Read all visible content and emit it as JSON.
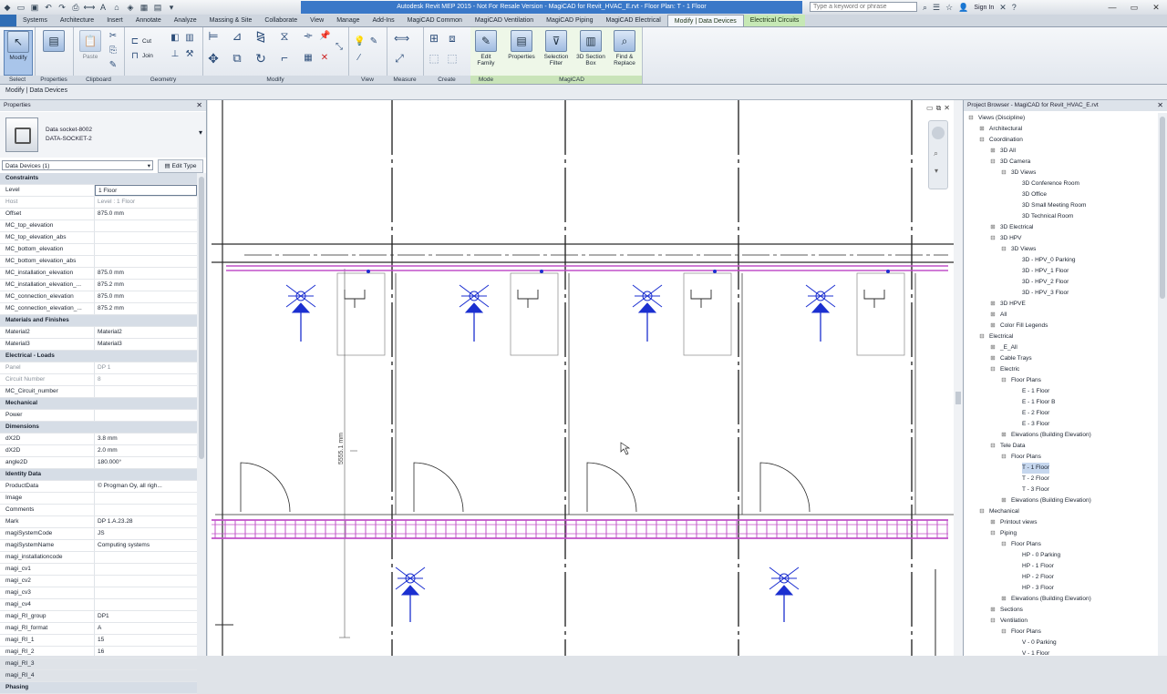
{
  "window": {
    "title": "Autodesk Revit MEP 2015 - Not For Resale Version -   MagiCAD for Revit_HVAC_E.rvt - Floor Plan: T - 1 Floor",
    "search_placeholder": "Type a keyword or phrase",
    "sign_in": "Sign In"
  },
  "tabs": [
    "Systems",
    "Architecture",
    "Insert",
    "Annotate",
    "Analyze",
    "Massing & Site",
    "Collaborate",
    "View",
    "Manage",
    "Add-Ins",
    "MagiCAD Common",
    "MagiCAD Ventilation",
    "MagiCAD Piping",
    "MagiCAD Electrical",
    "Modify | Data Devices",
    "Electrical Circuits"
  ],
  "ribbon": {
    "modify_label": "Modify",
    "select_label": "Select",
    "properties_label": "Properties",
    "clipboard_label": "Clipboard",
    "geometry_label": "Geometry",
    "modify_panel_label": "Modify",
    "view_label": "View",
    "measure_label": "Measure",
    "create_label": "Create",
    "mode_label": "Mode",
    "magicad_label": "MagiCAD",
    "paste_label": "Paste",
    "cut_label": "Cut",
    "join_label": "Join",
    "edit_family_label": "Edit Family",
    "mc_properties_label": "Properties",
    "selection_filter_label": "Selection Filter",
    "section_box_label": "3D Section Box",
    "find_replace_label": "Find & Replace"
  },
  "options_bar": {
    "text": "Modify | Data Devices"
  },
  "properties": {
    "title": "Properties",
    "type_name": "Data socket-8002",
    "type_sub": "DATA-SOCKET-2",
    "filter": "Data Devices (1)",
    "edit_type": "Edit Type",
    "rows": [
      {
        "cat": "Constraints"
      },
      {
        "k": "Level",
        "v": "1 Floor",
        "edit": true
      },
      {
        "k": "Host",
        "v": "Level : 1 Floor",
        "grey": true
      },
      {
        "k": "Offset",
        "v": "875.0 mm"
      },
      {
        "k": "MC_top_elevation",
        "v": ""
      },
      {
        "k": "MC_top_elevation_abs",
        "v": ""
      },
      {
        "k": "MC_bottom_elevation",
        "v": ""
      },
      {
        "k": "MC_bottom_elevation_abs",
        "v": ""
      },
      {
        "k": "MC_installation_elevation",
        "v": "875.0 mm"
      },
      {
        "k": "MC_installation_elevation_...",
        "v": "875.2 mm"
      },
      {
        "k": "MC_connection_elevation",
        "v": "875.0 mm"
      },
      {
        "k": "MC_connection_elevation_...",
        "v": "875.2 mm"
      },
      {
        "cat": "Materials and Finishes"
      },
      {
        "k": "Material2",
        "v": "Material2"
      },
      {
        "k": "Material3",
        "v": "Material3"
      },
      {
        "cat": "Electrical - Loads"
      },
      {
        "k": "Panel",
        "v": "DP 1",
        "grey": true
      },
      {
        "k": "Circuit Number",
        "v": "8",
        "grey": true
      },
      {
        "k": "MC_Circuit_number",
        "v": ""
      },
      {
        "cat": "Mechanical"
      },
      {
        "k": "Power",
        "v": ""
      },
      {
        "cat": "Dimensions"
      },
      {
        "k": "dX2D",
        "v": "3.8 mm"
      },
      {
        "k": "dX2D",
        "v": "2.0 mm"
      },
      {
        "k": "angle2D",
        "v": "180.000°"
      },
      {
        "cat": "Identity Data"
      },
      {
        "k": "ProductData",
        "v": "© Progman Oy, all righ..."
      },
      {
        "k": "Image",
        "v": ""
      },
      {
        "k": "Comments",
        "v": ""
      },
      {
        "k": "Mark",
        "v": "DP 1.A.23.28"
      },
      {
        "k": "magiSystemCode",
        "v": "JS"
      },
      {
        "k": "magiSystemName",
        "v": "Computing systems"
      },
      {
        "k": "magi_installationcode",
        "v": ""
      },
      {
        "k": "magi_cv1",
        "v": ""
      },
      {
        "k": "magi_cv2",
        "v": ""
      },
      {
        "k": "magi_cv3",
        "v": ""
      },
      {
        "k": "magi_cv4",
        "v": ""
      },
      {
        "k": "magi_RI_group",
        "v": "DP1"
      },
      {
        "k": "magi_RI_format",
        "v": "A"
      },
      {
        "k": "magi_RI_1",
        "v": "15"
      },
      {
        "k": "magi_RI_2",
        "v": "16"
      },
      {
        "k": "magi_RI_3",
        "v": ""
      },
      {
        "k": "magi_RI_4",
        "v": ""
      },
      {
        "cat": "Phasing"
      }
    ]
  },
  "canvas": {
    "dimension_text": "5555.1 mm"
  },
  "browser": {
    "title": "Project Browser - MagiCAD for Revit_HVAC_E.rvt",
    "nodes": [
      {
        "d": 0,
        "t": "Views (Discipline)",
        "tog": "−"
      },
      {
        "d": 1,
        "t": "Architectural",
        "tog": "+"
      },
      {
        "d": 1,
        "t": "Coordination",
        "tog": "−"
      },
      {
        "d": 2,
        "t": "3D All",
        "tog": "+"
      },
      {
        "d": 2,
        "t": "3D Camera",
        "tog": "−"
      },
      {
        "d": 3,
        "t": "3D Views",
        "tog": "−"
      },
      {
        "d": 4,
        "t": "3D Conference Room"
      },
      {
        "d": 4,
        "t": "3D Office"
      },
      {
        "d": 4,
        "t": "3D Small Meeting Room"
      },
      {
        "d": 4,
        "t": "3D Technical Room"
      },
      {
        "d": 2,
        "t": "3D Electrical",
        "tog": "+"
      },
      {
        "d": 2,
        "t": "3D HPV",
        "tog": "−"
      },
      {
        "d": 3,
        "t": "3D Views",
        "tog": "−"
      },
      {
        "d": 4,
        "t": "3D - HPV_0 Parking"
      },
      {
        "d": 4,
        "t": "3D - HPV_1 Floor"
      },
      {
        "d": 4,
        "t": "3D - HPV_2 Floor"
      },
      {
        "d": 4,
        "t": "3D - HPV_3 Floor"
      },
      {
        "d": 2,
        "t": "3D HPVE",
        "tog": "+"
      },
      {
        "d": 2,
        "t": "All",
        "tog": "+"
      },
      {
        "d": 2,
        "t": "Color Fill Legends",
        "tog": "+"
      },
      {
        "d": 1,
        "t": "Electrical",
        "tog": "−"
      },
      {
        "d": 2,
        "t": "_E_All",
        "tog": "+"
      },
      {
        "d": 2,
        "t": "Cable Trays",
        "tog": "+"
      },
      {
        "d": 2,
        "t": "Electric",
        "tog": "−"
      },
      {
        "d": 3,
        "t": "Floor Plans",
        "tog": "−"
      },
      {
        "d": 4,
        "t": "E - 1 Floor"
      },
      {
        "d": 4,
        "t": "E - 1 Floor B"
      },
      {
        "d": 4,
        "t": "E - 2 Floor"
      },
      {
        "d": 4,
        "t": "E - 3 Floor"
      },
      {
        "d": 3,
        "t": "Elevations (Building Elevation)",
        "tog": "+"
      },
      {
        "d": 2,
        "t": "Tele Data",
        "tog": "−"
      },
      {
        "d": 3,
        "t": "Floor Plans",
        "tog": "−"
      },
      {
        "d": 4,
        "t": "T - 1 Floor",
        "hl": true
      },
      {
        "d": 4,
        "t": "T - 2 Floor"
      },
      {
        "d": 4,
        "t": "T - 3 Floor"
      },
      {
        "d": 3,
        "t": "Elevations (Building Elevation)",
        "tog": "+"
      },
      {
        "d": 1,
        "t": "Mechanical",
        "tog": "−"
      },
      {
        "d": 2,
        "t": "Printout views",
        "tog": "+"
      },
      {
        "d": 2,
        "t": "Piping",
        "tog": "−"
      },
      {
        "d": 3,
        "t": "Floor Plans",
        "tog": "−"
      },
      {
        "d": 4,
        "t": "HP - 0 Parking"
      },
      {
        "d": 4,
        "t": "HP - 1 Floor"
      },
      {
        "d": 4,
        "t": "HP - 2 Floor"
      },
      {
        "d": 4,
        "t": "HP - 3 Floor"
      },
      {
        "d": 3,
        "t": "Elevations (Building Elevation)",
        "tog": "+"
      },
      {
        "d": 2,
        "t": "Sections",
        "tog": "+"
      },
      {
        "d": 2,
        "t": "Ventilation",
        "tog": "−"
      },
      {
        "d": 3,
        "t": "Floor Plans",
        "tog": "−"
      },
      {
        "d": 4,
        "t": "V - 0 Parking"
      },
      {
        "d": 4,
        "t": "V - 1 Floor"
      }
    ]
  },
  "colors": {
    "accent": "#3a78c8",
    "ctx_tab": "#c6e8b5",
    "cable_tray": "#c050c8",
    "device": "#1b2fd0"
  }
}
